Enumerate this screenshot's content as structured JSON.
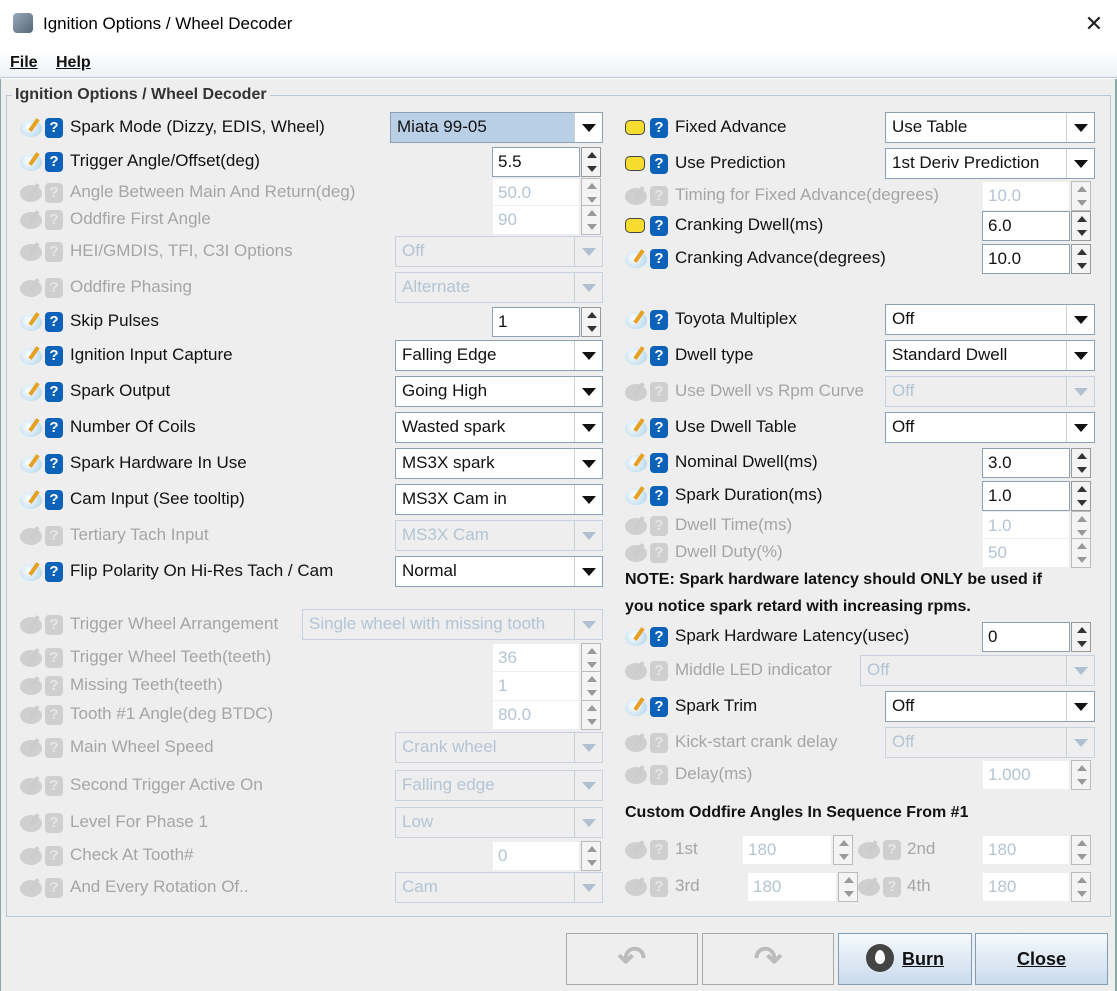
{
  "window": {
    "title": "Ignition Options / Wheel Decoder",
    "close": "✕"
  },
  "menu": {
    "file": "File",
    "help": "Help"
  },
  "group_title": "Ignition Options / Wheel Decoder",
  "left": [
    {
      "label": "Spark Mode (Dizzy, EDIS, Wheel)",
      "type": "combo",
      "value": "Miata 99-05",
      "enabled": true,
      "selected": true
    },
    {
      "label": "Trigger Angle/Offset(deg)",
      "type": "spin",
      "value": "5.5",
      "enabled": true
    },
    {
      "label": "Angle Between Main And Return(deg)",
      "type": "spin",
      "value": "50.0",
      "enabled": false
    },
    {
      "label": "Oddfire First Angle",
      "type": "spin",
      "value": "90",
      "enabled": false
    },
    {
      "label": "HEI/GMDIS, TFI, C3I Options",
      "type": "combo",
      "value": "Off",
      "enabled": false
    },
    {
      "label": "Oddfire Phasing",
      "type": "combo",
      "value": "Alternate",
      "enabled": false
    },
    {
      "label": "Skip Pulses",
      "type": "spin",
      "value": "1",
      "enabled": true
    },
    {
      "label": "Ignition Input Capture",
      "type": "combo",
      "value": "Falling Edge",
      "enabled": true
    },
    {
      "label": "Spark Output",
      "type": "combo",
      "value": "Going High",
      "enabled": true
    },
    {
      "label": "Number Of Coils",
      "type": "combo",
      "value": "Wasted spark",
      "enabled": true
    },
    {
      "label": "Spark Hardware In Use",
      "type": "combo",
      "value": "MS3X spark",
      "enabled": true
    },
    {
      "label": "Cam Input (See tooltip)",
      "type": "combo",
      "value": "MS3X Cam in",
      "enabled": true
    },
    {
      "label": "Tertiary Tach Input",
      "type": "combo",
      "value": "MS3X Cam",
      "enabled": false
    },
    {
      "label": "Flip Polarity On Hi-Res Tach / Cam",
      "type": "combo",
      "value": "Normal",
      "enabled": true
    },
    {
      "label": "Trigger Wheel Arrangement",
      "type": "combo",
      "value": "Single wheel with missing tooth",
      "enabled": false
    },
    {
      "label": "Trigger Wheel Teeth(teeth)",
      "type": "spin",
      "value": "36",
      "enabled": false
    },
    {
      "label": "Missing Teeth(teeth)",
      "type": "spin",
      "value": "1",
      "enabled": false
    },
    {
      "label": "Tooth #1 Angle(deg BTDC)",
      "type": "spin",
      "value": "80.0",
      "enabled": false
    },
    {
      "label": "Main Wheel Speed",
      "type": "combo",
      "value": "Crank wheel",
      "enabled": false
    },
    {
      "label": "Second Trigger Active On",
      "type": "combo",
      "value": "Falling edge",
      "enabled": false
    },
    {
      "label": "Level For Phase 1",
      "type": "combo",
      "value": "Low",
      "enabled": false
    },
    {
      "label": "Check At Tooth#",
      "type": "spin",
      "value": "0",
      "enabled": false
    },
    {
      "label": "And Every Rotation Of..",
      "type": "combo",
      "value": "Cam",
      "enabled": false
    }
  ],
  "right": [
    {
      "label": "Fixed Advance",
      "type": "combo",
      "value": "Use Table",
      "enabled": true,
      "yellow": true
    },
    {
      "label": "Use Prediction",
      "type": "combo",
      "value": "1st Deriv Prediction",
      "enabled": true,
      "yellow": true
    },
    {
      "label": "Timing for Fixed Advance(degrees)",
      "type": "spin",
      "value": "10.0",
      "enabled": false
    },
    {
      "label": "Cranking Dwell(ms)",
      "type": "spin",
      "value": "6.0",
      "enabled": true,
      "yellow": true
    },
    {
      "label": "Cranking Advance(degrees)",
      "type": "spin",
      "value": "10.0",
      "enabled": true
    },
    {
      "label": "Toyota Multiplex",
      "type": "combo",
      "value": "Off",
      "enabled": true
    },
    {
      "label": "Dwell type",
      "type": "combo",
      "value": "Standard Dwell",
      "enabled": true
    },
    {
      "label": "Use Dwell vs Rpm Curve",
      "type": "combo",
      "value": "Off",
      "enabled": false
    },
    {
      "label": "Use Dwell Table",
      "type": "combo",
      "value": "Off",
      "enabled": true
    },
    {
      "label": "Nominal Dwell(ms)",
      "type": "spin",
      "value": "3.0",
      "enabled": true
    },
    {
      "label": "Spark Duration(ms)",
      "type": "spin",
      "value": "1.0",
      "enabled": true
    },
    {
      "label": "Dwell Time(ms)",
      "type": "spin",
      "value": "1.0",
      "enabled": false
    },
    {
      "label": "Dwell Duty(%)",
      "type": "spin",
      "value": "50",
      "enabled": false
    },
    {
      "label": "Spark Hardware Latency(usec)",
      "type": "spin",
      "value": "0",
      "enabled": true
    },
    {
      "label": "Middle LED indicator",
      "type": "combo",
      "value": "Off",
      "enabled": false
    },
    {
      "label": "Spark Trim",
      "type": "combo",
      "value": "Off",
      "enabled": true
    },
    {
      "label": "Kick-start crank delay",
      "type": "combo",
      "value": "Off",
      "enabled": false
    },
    {
      "label": "Delay(ms)",
      "type": "spin",
      "value": "1.000",
      "enabled": false
    },
    {
      "label": "1st",
      "type": "spin",
      "value": "180",
      "enabled": false
    },
    {
      "label": "2nd",
      "type": "spin",
      "value": "180",
      "enabled": false
    },
    {
      "label": "3rd",
      "type": "spin",
      "value": "180",
      "enabled": false
    },
    {
      "label": "4th",
      "type": "spin",
      "value": "180",
      "enabled": false
    }
  ],
  "note_line1": "NOTE: Spark hardware latency should ONLY be used if",
  "note_line2": "you notice spark retard with increasing rpms.",
  "oddfire_heading": "Custom Oddfire Angles In Sequence From #1",
  "buttons": {
    "undo": "↶",
    "redo": "↷",
    "burn": "Burn",
    "close": "Close"
  }
}
